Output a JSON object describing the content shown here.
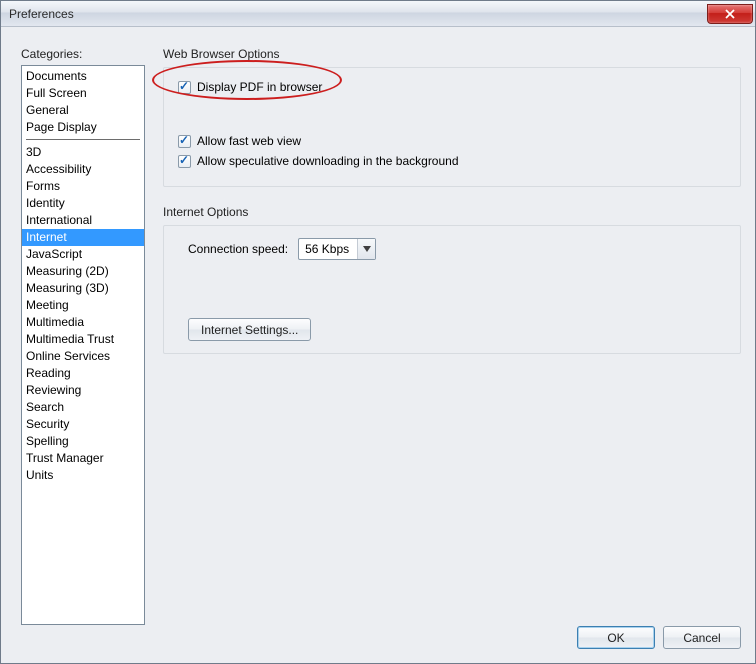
{
  "window": {
    "title": "Preferences"
  },
  "sidebar": {
    "label": "Categories:",
    "items_top": [
      "Documents",
      "Full Screen",
      "General",
      "Page Display"
    ],
    "items_bottom": [
      "3D",
      "Accessibility",
      "Forms",
      "Identity",
      "International",
      "Internet",
      "JavaScript",
      "Measuring (2D)",
      "Measuring (3D)",
      "Meeting",
      "Multimedia",
      "Multimedia Trust",
      "Online Services",
      "Reading",
      "Reviewing",
      "Search",
      "Security",
      "Spelling",
      "Trust Manager",
      "Units"
    ],
    "selected": "Internet"
  },
  "web_browser": {
    "group_label": "Web Browser Options",
    "display_pdf": {
      "label": "Display PDF in browser",
      "checked": true
    },
    "fast_web": {
      "label": "Allow fast web view",
      "checked": true
    },
    "speculative": {
      "label": "Allow speculative downloading in the background",
      "checked": true
    }
  },
  "internet_options": {
    "group_label": "Internet Options",
    "connection_label": "Connection speed:",
    "connection_value": "56 Kbps",
    "settings_button": "Internet Settings..."
  },
  "footer": {
    "ok": "OK",
    "cancel": "Cancel"
  }
}
